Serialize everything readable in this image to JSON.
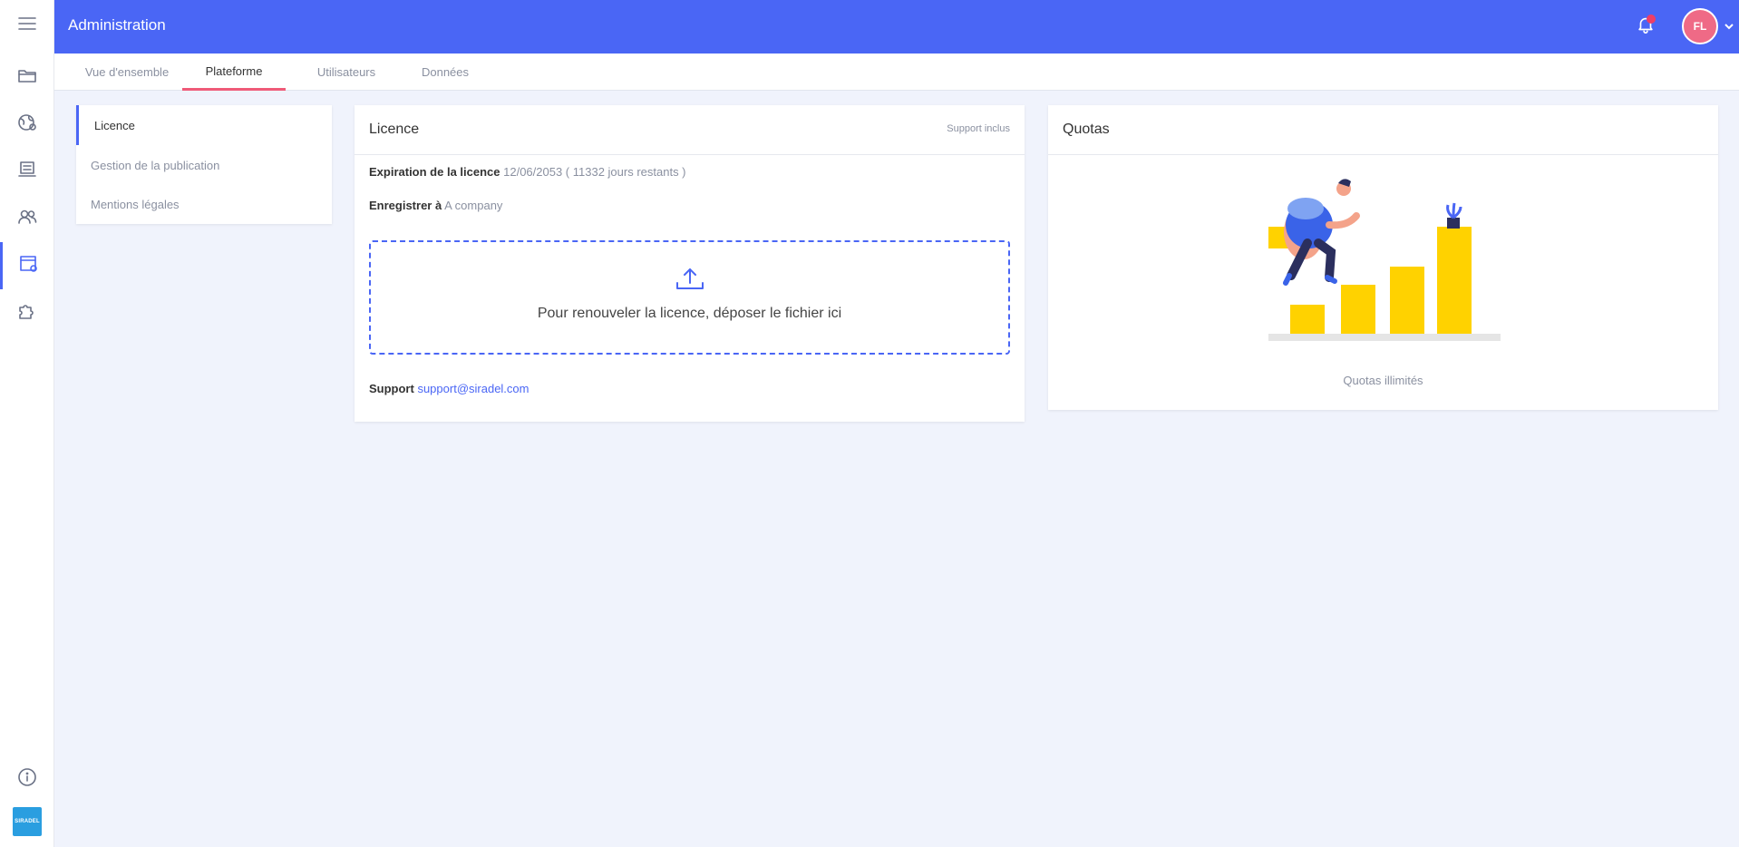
{
  "app": {
    "title": "Administration",
    "logo_text": "SIRADEL"
  },
  "user": {
    "initials": "FL"
  },
  "rail": {
    "items": [
      {
        "icon": "folder-icon"
      },
      {
        "icon": "globe-icon"
      },
      {
        "icon": "catalog-icon"
      },
      {
        "icon": "users-icon"
      },
      {
        "icon": "admin-settings-icon"
      },
      {
        "icon": "puzzle-icon"
      }
    ],
    "bottom_icon": "info-icon"
  },
  "tabs": [
    "Vue d'ensemble",
    "Plateforme",
    "Utilisateurs",
    "Données"
  ],
  "active_tab": "Plateforme",
  "submenu": {
    "items": [
      "Licence",
      "Gestion de la publication",
      "Mentions légales"
    ],
    "active": "Licence"
  },
  "licence": {
    "title": "Licence",
    "badge": "Support inclus",
    "expiration_label": "Expiration de la licence",
    "expiration_value": "12/06/2053 ( 11332 jours restants )",
    "registered_label": "Enregistrer à",
    "registered_value": "A company",
    "dropzone_text": "Pour renouveler la licence, déposer le fichier ici",
    "support_label": "Support",
    "support_email": "support@siradel.com"
  },
  "quotas": {
    "title": "Quotas",
    "caption": "Quotas illimités"
  },
  "colors": {
    "primary": "#4a66f5",
    "accent": "#ef5a78",
    "background": "#f0f3fc",
    "illustration_yellow": "#ffd200"
  }
}
